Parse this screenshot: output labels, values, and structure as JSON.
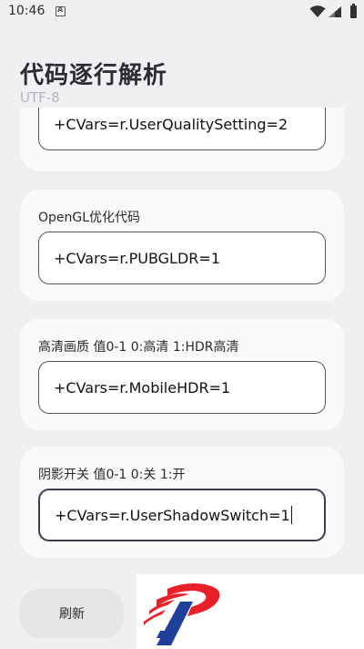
{
  "status_bar": {
    "time": "10:46",
    "notification_icon": "a-square-icon",
    "wifi_icon": "wifi-icon",
    "signal_icon": "signal-icon",
    "battery_icon": "battery-icon"
  },
  "header": {
    "title": "代码逐行解析",
    "subtitle": "UTF-8"
  },
  "cards": [
    {
      "label": "",
      "code": "+CVars=r.UserQualitySetting=2"
    },
    {
      "label": "OpenGL优化代码",
      "code": "+CVars=r.PUBGLDR=1"
    },
    {
      "label": "高清画质 值0-1 0:高清 1:HDR高清",
      "code": "+CVars=r.MobileHDR=1"
    },
    {
      "label": "阴影开关 值0-1 0:关 1:开",
      "code": "+CVars=r.UserShadowSwitch=1"
    }
  ],
  "bottom": {
    "refresh_label": "刷新",
    "logo_icon": "brand-logo-icon"
  },
  "colors": {
    "background": "#f0f0f2",
    "card": "#fafafa",
    "title": "#2b2d33",
    "subtitle": "#b3b6bd",
    "logo_red": "#e8202a",
    "logo_blue": "#1f3f9a"
  }
}
